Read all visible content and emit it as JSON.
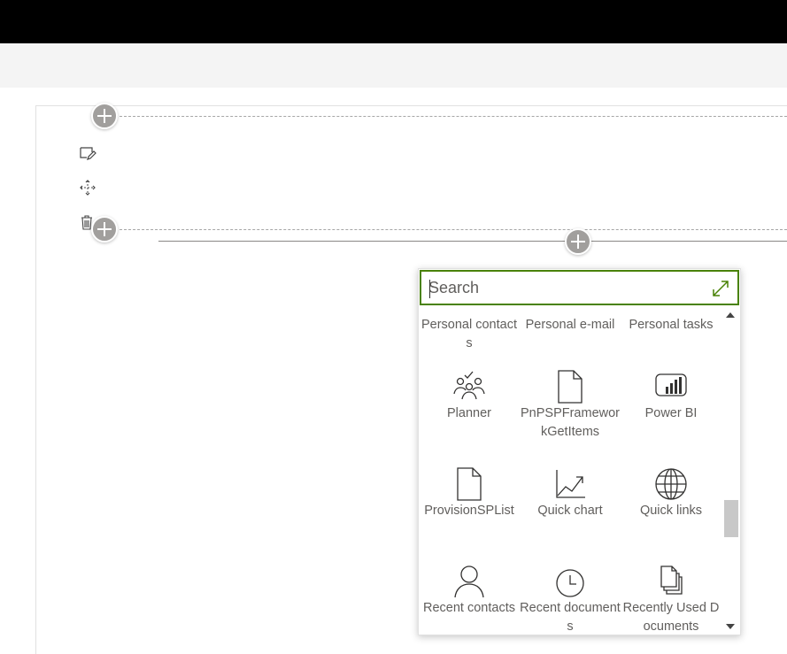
{
  "page": {
    "accent_color": "#498205",
    "add_button_color": "#a19f9d"
  },
  "search": {
    "placeholder": "Search",
    "value": ""
  },
  "webparts": [
    {
      "label": "Personal contacts",
      "icon": "contacts-icon"
    },
    {
      "label": "Personal e-mail",
      "icon": "mail-icon"
    },
    {
      "label": "Personal tasks",
      "icon": "tasks-icon"
    },
    {
      "label": "Planner",
      "icon": "people-team-icon"
    },
    {
      "label": "PnPSPFrameworkGetItems",
      "icon": "document-icon"
    },
    {
      "label": "Power BI",
      "icon": "power-bi-icon"
    },
    {
      "label": "ProvisionSPList",
      "icon": "document-icon"
    },
    {
      "label": "Quick chart",
      "icon": "chart-icon"
    },
    {
      "label": "Quick links",
      "icon": "globe-icon"
    },
    {
      "label": "Recent contacts",
      "icon": "person-icon"
    },
    {
      "label": "Recent documents",
      "icon": "clock-icon"
    },
    {
      "label": "Recently Used Documents",
      "icon": "documents-stack-icon"
    }
  ]
}
